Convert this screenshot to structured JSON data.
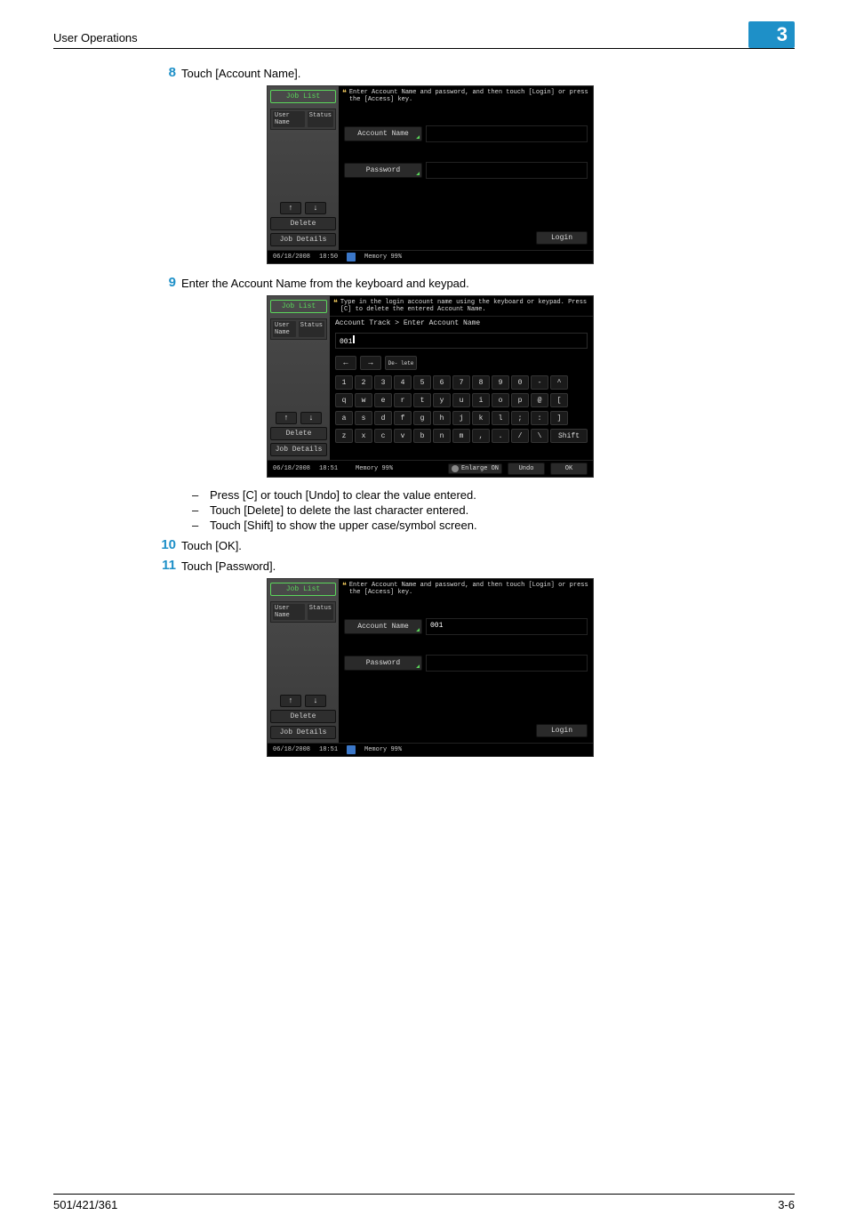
{
  "header": {
    "section_title": "User Operations",
    "chapter_number": "3"
  },
  "footer": {
    "left": "501/421/361",
    "right": "3-6"
  },
  "steps": [
    {
      "id": 0,
      "number": "8",
      "text": "Touch [Account Name]."
    },
    {
      "id": 1,
      "number": "9",
      "text": "Enter the Account Name from the keyboard and keypad."
    },
    {
      "id": 2,
      "number": "10",
      "text": "Touch [OK]."
    },
    {
      "id": 3,
      "number": "11",
      "text": "Touch [Password]."
    }
  ],
  "sub_step9": [
    "Press [C] or touch [Undo] to clear the value entered.",
    "Touch [Delete] to delete the last character entered.",
    "Touch [Shift] to show the upper case/symbol screen."
  ],
  "screenshot_common": {
    "side": {
      "job_list": "Job List",
      "user_name": "User Name",
      "status": "Status",
      "delete": "Delete",
      "job_details": "Job Details",
      "arrow_up": "↑",
      "arrow_down": "↓"
    },
    "status": {
      "date": "06/18/2008",
      "time_a": "18:50",
      "time_b": "18:51",
      "memory_label": "Memory",
      "memory_value": "99%",
      "glyph_name": "status-icon"
    }
  },
  "screenshot_login": {
    "hint": "Enter Account Name and password, and then touch [Login] or press the [Access] key.",
    "field_account": "Account Name",
    "field_password": "Password",
    "login_btn": "Login",
    "account_value_empty": "",
    "account_value_filled": "001"
  },
  "screenshot_keyboard": {
    "hint": "Type in the login account name using the keyboard or keypad. Press [C] to delete the entered Account Name.",
    "crumb": "Account Track > Enter Account Name",
    "input_value": "001",
    "shift_label": "Shift",
    "delete_key": "De-\nlete",
    "undo": "Undo",
    "ok": "OK",
    "enlarge_label": "Enlarge",
    "enlarge_state": "ON",
    "row1": [
      "1",
      "2",
      "3",
      "4",
      "5",
      "6",
      "7",
      "8",
      "9",
      "0",
      "-",
      "^"
    ],
    "row2": [
      "q",
      "w",
      "e",
      "r",
      "t",
      "y",
      "u",
      "i",
      "o",
      "p",
      "@",
      "["
    ],
    "row3": [
      "a",
      "s",
      "d",
      "f",
      "g",
      "h",
      "j",
      "k",
      "l",
      ";",
      ":",
      "]"
    ],
    "row4": [
      "z",
      "x",
      "c",
      "v",
      "b",
      "n",
      "m",
      ",",
      ".",
      "/",
      "\\"
    ]
  }
}
